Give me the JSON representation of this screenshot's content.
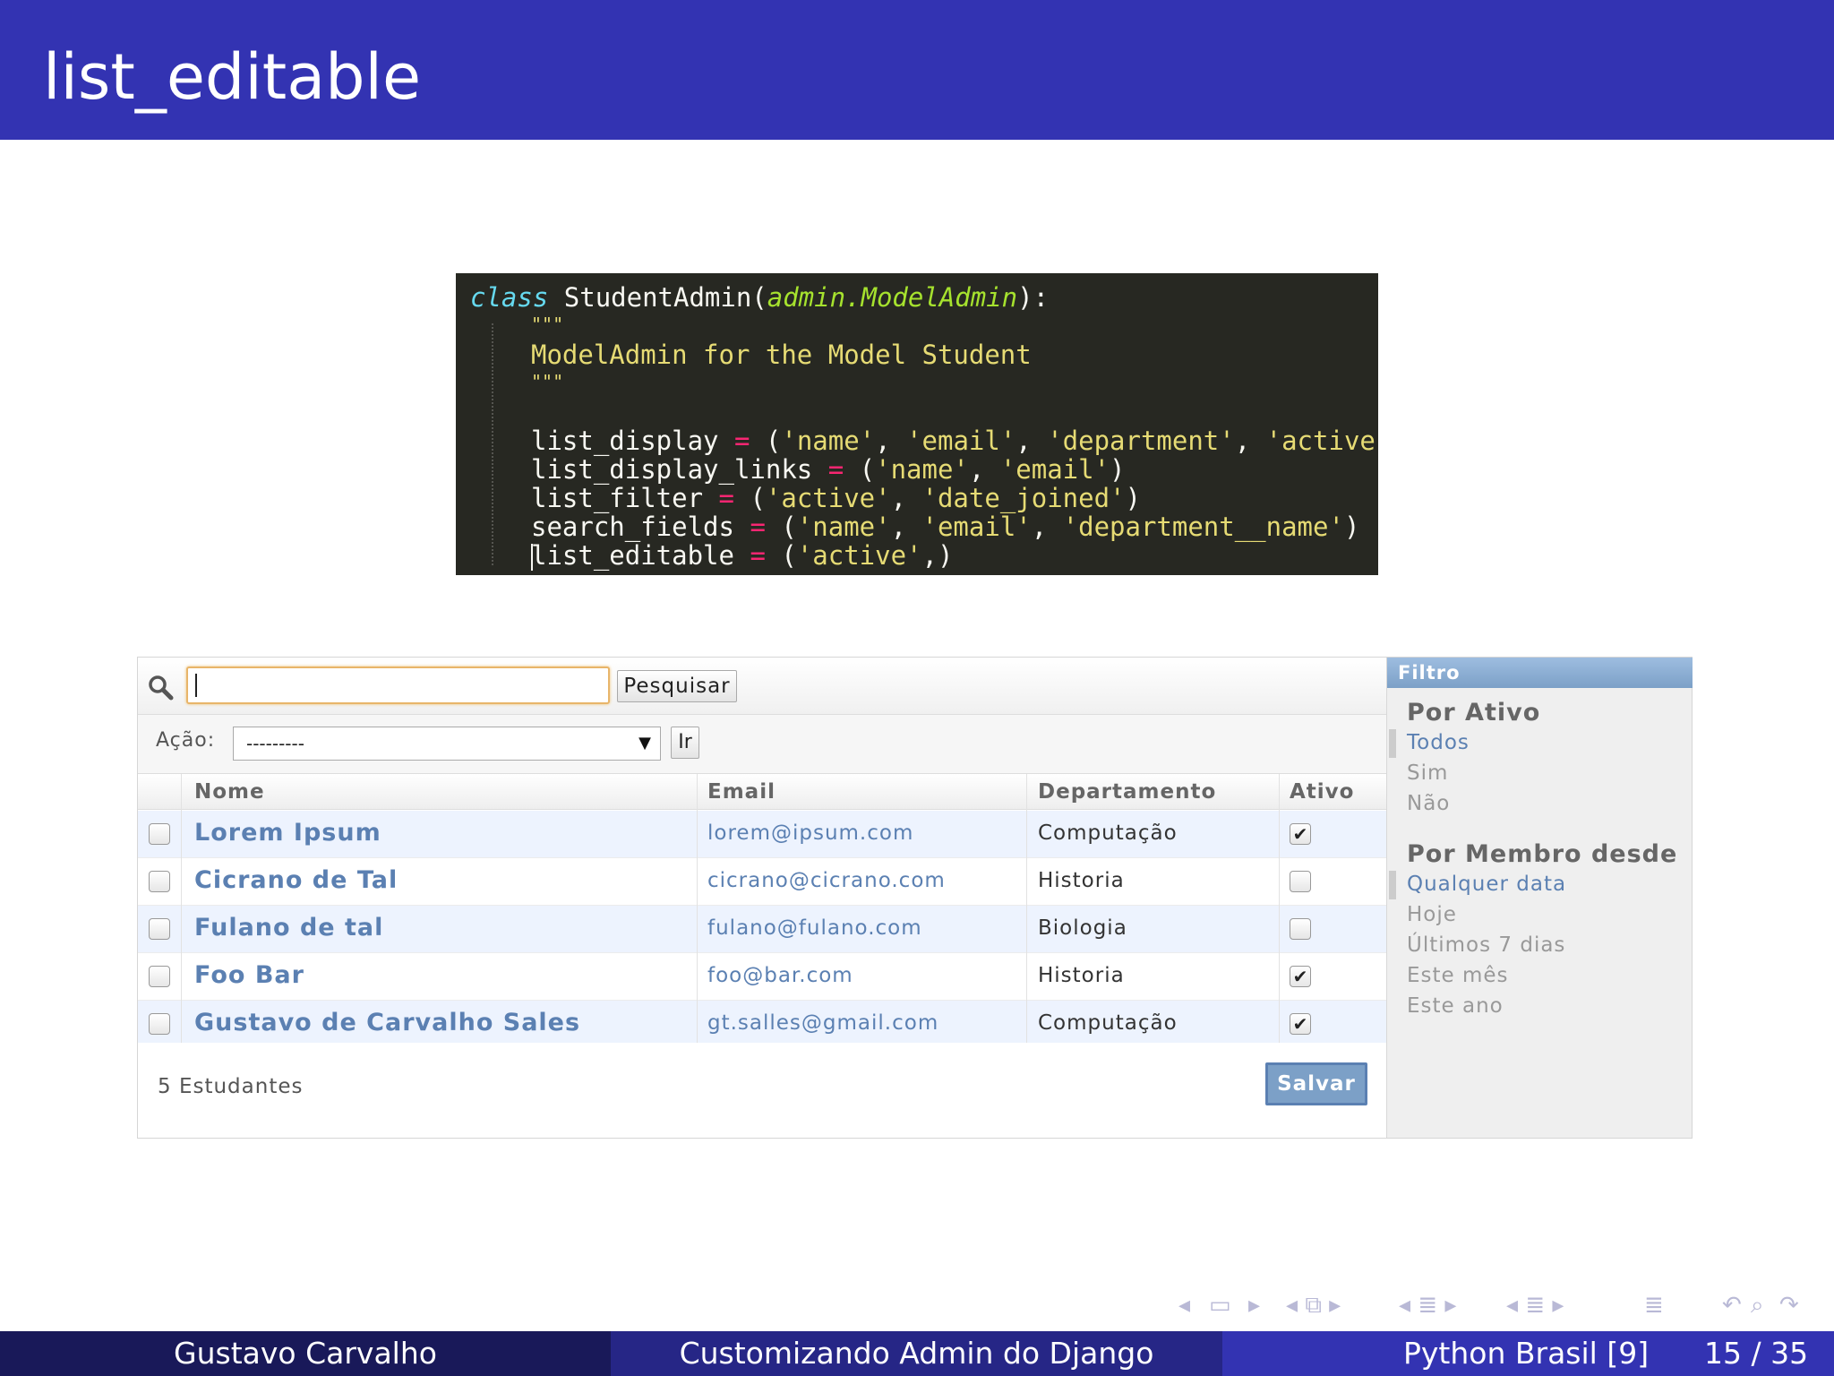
{
  "slide": {
    "title": "list_editable"
  },
  "code": {
    "line1": {
      "kw": "class",
      "name": " StudentAdmin(",
      "inherit": "admin.ModelAdmin",
      "end": "):"
    },
    "doc_open": "\"\"\"",
    "doc_text": "ModelAdmin for the Model Student",
    "doc_close": "\"\"\"",
    "l_display": {
      "var": "list_display ",
      "op": "=",
      "open": " (",
      "s1": "'name'",
      "s2": "'email'",
      "s3": "'department'",
      "s4": "'active'",
      "close": ")"
    },
    "l_links": {
      "var": "list_display_links ",
      "op": "=",
      "open": " (",
      "s1": "'name'",
      "s2": "'email'",
      "close": ")"
    },
    "l_filter": {
      "var": "list_filter ",
      "op": "=",
      "open": " (",
      "s1": "'active'",
      "s2": "'date_joined'",
      "close": ")"
    },
    "l_search": {
      "var": "search_fields ",
      "op": "=",
      "open": " (",
      "s1": "'name'",
      "s2": "'email'",
      "s3": "'department__name'",
      "close": ")"
    },
    "l_editable": {
      "var": "list_editable ",
      "op": "=",
      "open": " (",
      "s1": "'active'",
      "close": ",)"
    },
    "sep": ", "
  },
  "admin": {
    "search": {
      "value": "",
      "button": "Pesquisar"
    },
    "action": {
      "label": "Ação:",
      "selected": "---------",
      "go": "Ir"
    },
    "columns": [
      "Nome",
      "Email",
      "Departamento",
      "Ativo"
    ],
    "rows": [
      {
        "name": "Lorem Ipsum",
        "email": "lorem@ipsum.com",
        "department": "Computação",
        "active": true
      },
      {
        "name": "Cicrano de Tal",
        "email": "cicrano@cicrano.com",
        "department": "Historia",
        "active": false
      },
      {
        "name": "Fulano de tal",
        "email": "fulano@fulano.com",
        "department": "Biologia",
        "active": false
      },
      {
        "name": "Foo Bar",
        "email": "foo@bar.com",
        "department": "Historia",
        "active": true
      },
      {
        "name": "Gustavo de Carvalho Sales",
        "email": "gt.salles@gmail.com",
        "department": "Computação",
        "active": true
      }
    ],
    "count": "5 Estudantes",
    "save": "Salvar",
    "filter": {
      "header": "Filtro",
      "groups": [
        {
          "title": "Por Ativo",
          "options": [
            "Todos",
            "Sim",
            "Não"
          ],
          "selected": 0
        },
        {
          "title": "Por Membro desde",
          "options": [
            "Qualquer data",
            "Hoje",
            "Últimos 7 dias",
            "Este mês",
            "Este ano"
          ],
          "selected": 0
        }
      ]
    }
  },
  "checkmark": "✔",
  "footer": {
    "author": "Gustavo Carvalho",
    "talk": "Customizando Admin do Django",
    "conference": "Python Brasil [9]",
    "page": "15 / 35"
  },
  "nav_icons": [
    "nav-left-arrow-icon",
    "nav-frame-icon",
    "nav-right-arrow-icon",
    "nav-subsection-icon",
    "nav-section-icon",
    "nav-document-icon",
    "nav-back-icon",
    "nav-search-icon",
    "nav-forward-icon"
  ]
}
